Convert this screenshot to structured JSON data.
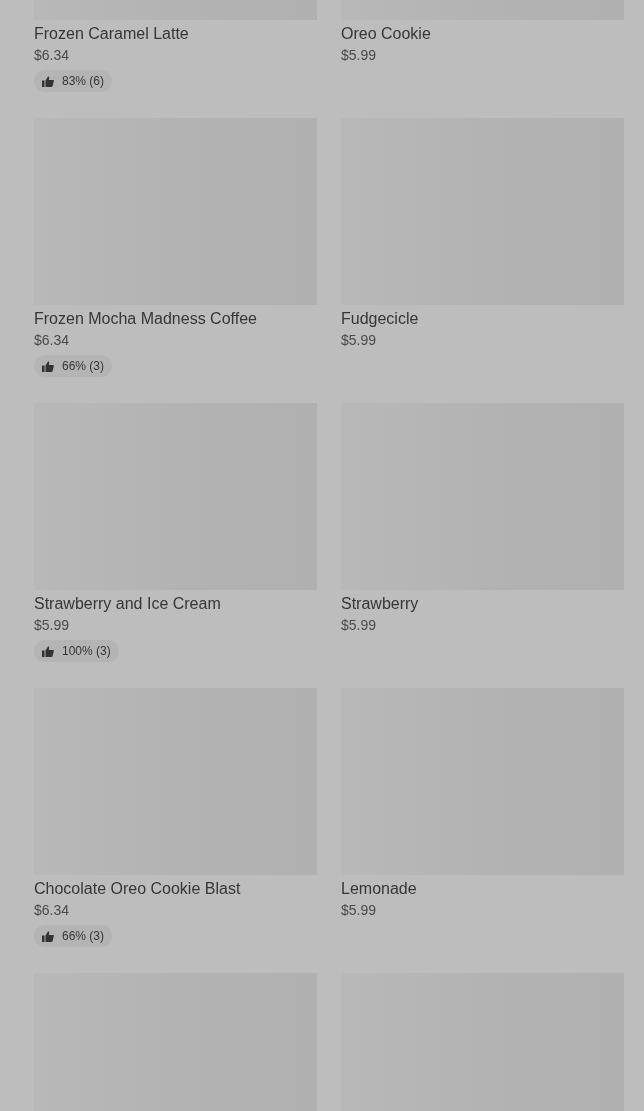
{
  "products": [
    {
      "kind": "product",
      "name": "Frozen Caramel Latte",
      "price": "$6.34",
      "rating": "83% (6)"
    },
    {
      "kind": "product",
      "name": "Oreo Cookie",
      "price": "$5.99"
    },
    {
      "kind": "product",
      "name": "Frozen Mocha Madness Coffee",
      "price": "$6.34",
      "rating": "66% (3)"
    },
    {
      "kind": "product",
      "name": "Fudgecicle",
      "price": "$5.99"
    },
    {
      "kind": "product",
      "name": "Strawberry and Ice Cream",
      "price": "$5.99",
      "rating": "100% (3)"
    },
    {
      "kind": "product",
      "name": "Strawberry",
      "price": "$5.99"
    },
    {
      "kind": "product",
      "name": "Chocolate Oreo Cookie Blast",
      "price": "$6.34",
      "rating": "66% (3)"
    },
    {
      "kind": "product",
      "name": "Lemonade",
      "price": "$5.99"
    },
    {
      "kind": "image_only"
    },
    {
      "kind": "image_only"
    }
  ]
}
